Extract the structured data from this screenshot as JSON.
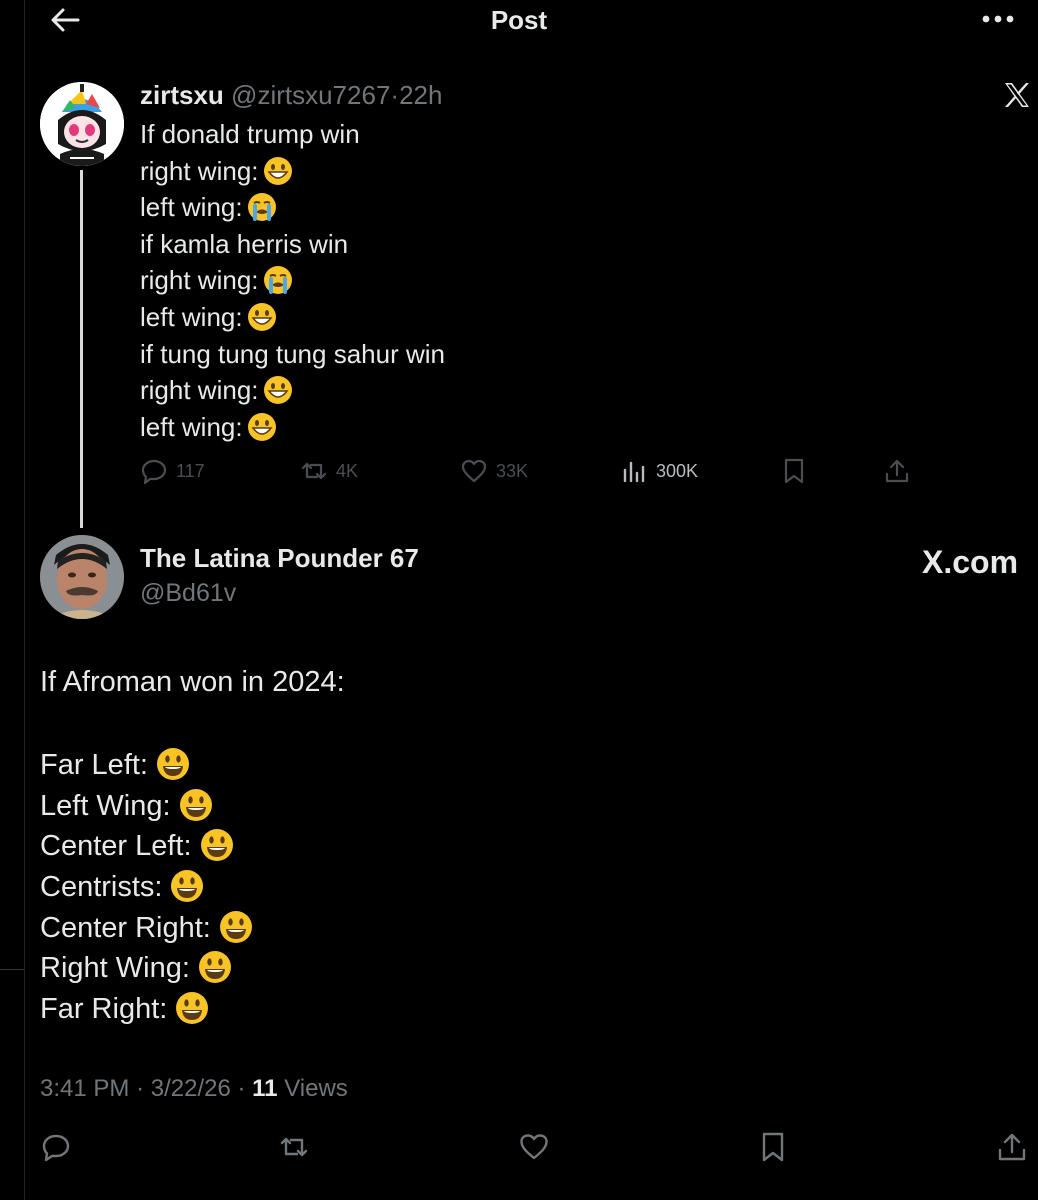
{
  "header": {
    "title": "Post"
  },
  "parent_tweet": {
    "display_name": "zirtsxu",
    "handle": "@zirtsxu7267",
    "separator": "·",
    "time": "22h",
    "lines": [
      {
        "text": "If donald trump win",
        "emoji": ""
      },
      {
        "text": "right wing:",
        "emoji": "grinning-face-icon"
      },
      {
        "text": "left wing:",
        "emoji": "crying-face-icon"
      },
      {
        "text": "if kamla herris win",
        "emoji": ""
      },
      {
        "text": "right wing:",
        "emoji": "crying-face-icon"
      },
      {
        "text": "left wing:",
        "emoji": "grinning-face-icon"
      },
      {
        "text": "if tung tung tung sahur win",
        "emoji": ""
      },
      {
        "text": "right wing:",
        "emoji": "grinning-face-icon"
      },
      {
        "text": "left wing:",
        "emoji": "grinning-face-icon"
      }
    ],
    "replies": "117",
    "reposts": "4K",
    "likes": "33K",
    "views": "300K"
  },
  "main_tweet": {
    "display_name": "The Latina Pounder 67",
    "handle": "@Bd61v",
    "brand": "X.com",
    "intro": "If Afroman won in 2024:",
    "lines": [
      {
        "text": "Far Left:",
        "emoji": "smiley-face-icon"
      },
      {
        "text": "Left Wing:",
        "emoji": "smiley-face-icon"
      },
      {
        "text": "Center Left:",
        "emoji": "smiley-face-icon"
      },
      {
        "text": "Centrists:",
        "emoji": "smiley-face-icon"
      },
      {
        "text": "Center Right:",
        "emoji": "smiley-face-icon"
      },
      {
        "text": "Right Wing:",
        "emoji": "smiley-face-icon"
      },
      {
        "text": "Far Right:",
        "emoji": "smiley-face-icon"
      }
    ],
    "time": "3:41 PM",
    "date": "3/22/26",
    "separator": "·",
    "views_count": "11",
    "views_label": "Views"
  },
  "colors": {
    "background": "#000000",
    "text": "#e7e9ea",
    "muted": "#71767b",
    "emoji": "#f7c325"
  }
}
